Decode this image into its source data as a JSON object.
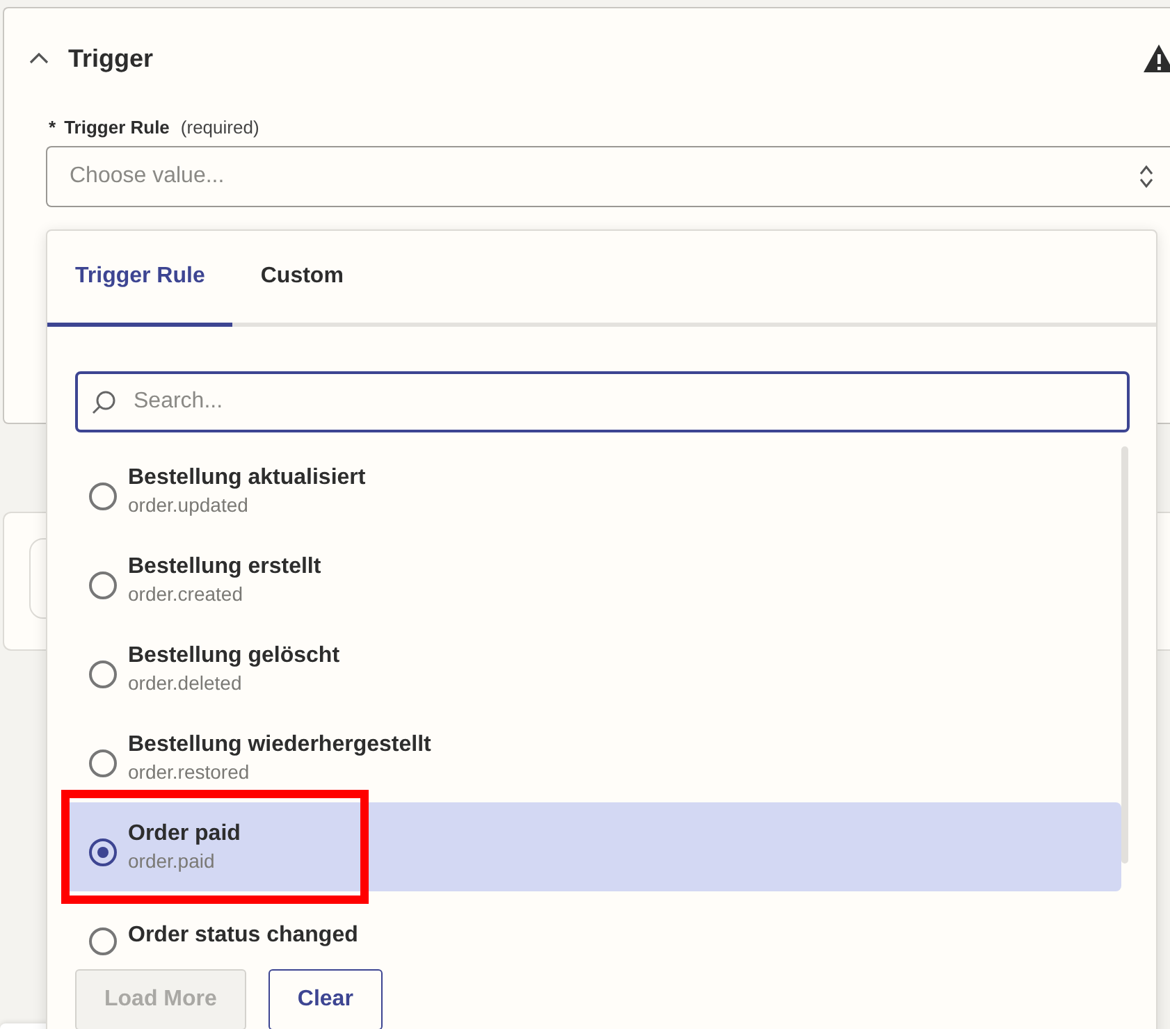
{
  "section": {
    "title": "Trigger",
    "expanded": true,
    "warning": true
  },
  "field": {
    "required_mark": "*",
    "label": "Trigger Rule",
    "hint": "(required)",
    "placeholder": "Choose value..."
  },
  "dropdown": {
    "tabs": [
      {
        "label": "Trigger Rule",
        "selected": true
      },
      {
        "label": "Custom",
        "selected": false
      }
    ],
    "search": {
      "placeholder": "Search..."
    },
    "options": [
      {
        "label": "Bestellung aktualisiert",
        "value": "order.updated",
        "selected": false,
        "highlighted": false
      },
      {
        "label": "Bestellung erstellt",
        "value": "order.created",
        "selected": false,
        "highlighted": false
      },
      {
        "label": "Bestellung gelöscht",
        "value": "order.deleted",
        "selected": false,
        "highlighted": false
      },
      {
        "label": "Bestellung wiederhergestellt",
        "value": "order.restored",
        "selected": false,
        "highlighted": false
      },
      {
        "label": "Order paid",
        "value": "order.paid",
        "selected": true,
        "highlighted": true
      },
      {
        "label": "Order status changed",
        "selected": false,
        "highlighted": false
      }
    ],
    "buttons": [
      {
        "label": "Load More",
        "disabled": true
      },
      {
        "label": "Clear",
        "disabled": false
      }
    ]
  }
}
